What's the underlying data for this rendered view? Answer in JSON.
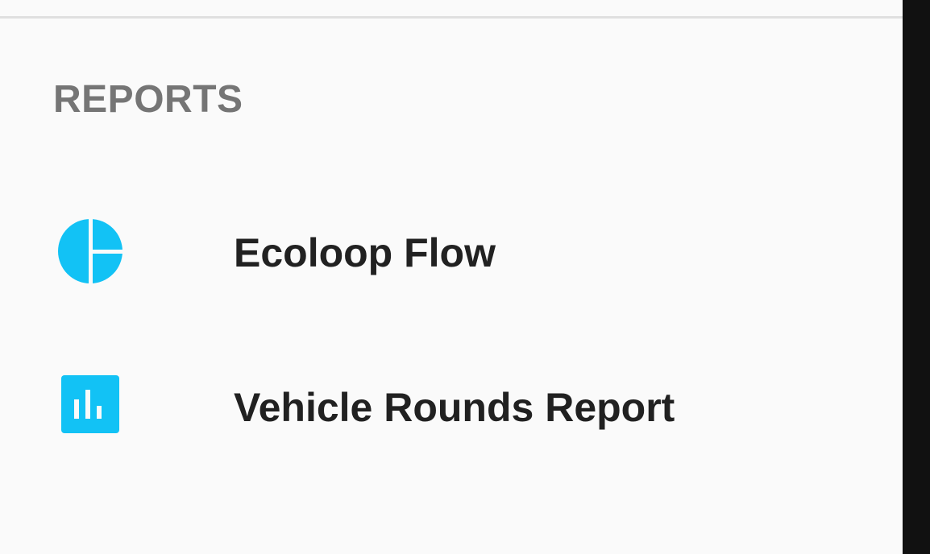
{
  "drawer": {
    "section_title": "REPORTS",
    "items": [
      {
        "label": "Ecoloop Flow",
        "icon": "pie-chart-icon"
      },
      {
        "label": "Vehicle Rounds Report",
        "icon": "bar-chart-icon"
      }
    ]
  },
  "colors": {
    "accent": "#12C2F5",
    "section_title": "#757575",
    "item_text": "#212121",
    "background": "#fafafa",
    "edge": "#111111"
  }
}
